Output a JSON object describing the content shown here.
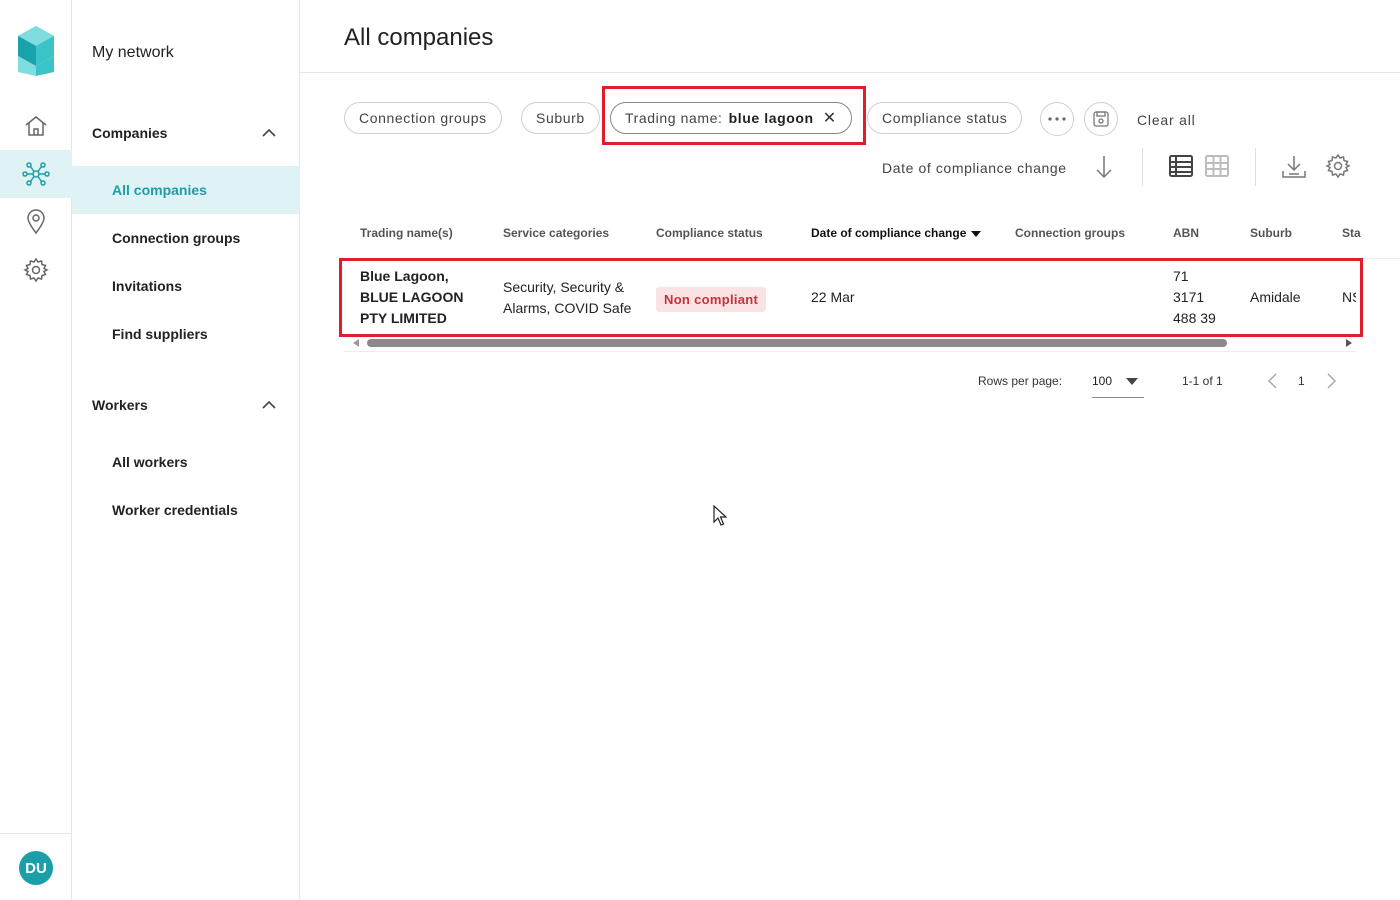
{
  "rail": {
    "avatar_initials": "DU",
    "icons": [
      "logo-icon",
      "home-icon",
      "network-icon",
      "location-icon",
      "settings-icon"
    ],
    "accent_color": "#1a9fa9"
  },
  "sidebar": {
    "title": "My network",
    "sections": [
      {
        "label": "Companies",
        "items": [
          "All companies",
          "Connection groups",
          "Invitations",
          "Find suppliers"
        ]
      },
      {
        "label": "Workers",
        "items": [
          "All workers",
          "Worker credentials"
        ]
      }
    ],
    "active_item": "All companies"
  },
  "main": {
    "title": "All companies",
    "filters": {
      "chip_connection_groups": "Connection groups",
      "chip_suburb": "Suburb",
      "chip_trading_label": "Trading name:",
      "chip_trading_value": "blue lagoon",
      "chip_compliance": "Compliance status",
      "clear_all": "Clear all"
    },
    "sort": {
      "label": "Date of compliance change"
    },
    "table": {
      "columns": [
        "Trading name(s)",
        "Service categories",
        "Compliance status",
        "Date of compliance change",
        "Connection groups",
        "ABN",
        "Suburb",
        "Sta"
      ],
      "sorted_column": "Date of compliance change",
      "rows": [
        {
          "trading_name_lines": [
            "Blue Lagoon,",
            "BLUE LAGOON",
            "PTY LIMITED"
          ],
          "service_lines": [
            "Security, Security &",
            "Alarms, COVID Safe"
          ],
          "compliance_status": "Non compliant",
          "date": "22 Mar",
          "connection_groups": "",
          "abn_lines": [
            "71",
            "3171",
            "488 39"
          ],
          "suburb": "Amidale",
          "state": "NS"
        }
      ]
    },
    "pagination": {
      "rows_per_page_label": "Rows per page:",
      "rows_per_page": "100",
      "range": "1-1 of 1",
      "page": "1"
    },
    "status_colors": {
      "non_compliant_bg": "#fbe3e3",
      "non_compliant_text": "#c4333c",
      "highlight": "#e01e2b"
    }
  }
}
